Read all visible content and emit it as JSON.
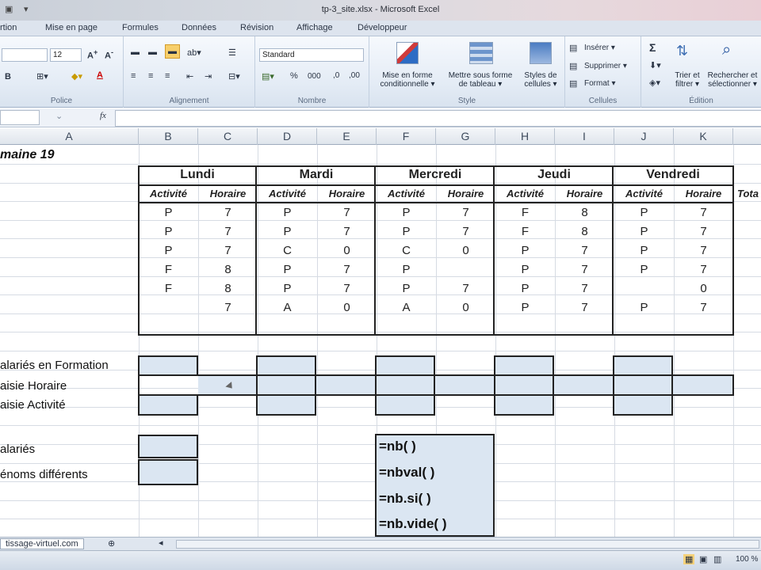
{
  "window": {
    "title": "tp-3_site.xlsx - Microsoft Excel"
  },
  "ribbon": {
    "tabs": [
      "rtion",
      "Mise en page",
      "Formules",
      "Données",
      "Révision",
      "Affichage",
      "Développeur"
    ],
    "font_size": "12",
    "number_format": "Standard",
    "groups": {
      "police": "Police",
      "alignement": "Alignement",
      "nombre": "Nombre",
      "style": "Style",
      "cellules": "Cellules",
      "edition": "Édition"
    },
    "style_buttons": {
      "mise_en_forme": [
        "Mise en forme",
        "conditionnelle ▾"
      ],
      "mettre_tableau": [
        "Mettre sous forme",
        "de tableau ▾"
      ],
      "styles_cellules": [
        "Styles de",
        "cellules ▾"
      ]
    },
    "cells_buttons": {
      "inserer": "Insérer ▾",
      "supprimer": "Supprimer ▾",
      "format": "Format ▾"
    },
    "edit_buttons": {
      "trier": [
        "Trier et",
        "filtrer ▾"
      ],
      "rechercher": [
        "Rechercher et",
        "sélectionner ▾"
      ]
    },
    "percent": "%",
    "thousands": "000",
    "sigma": "Σ"
  },
  "formula_bar": {
    "fx": "fx",
    "value": ""
  },
  "columns": [
    "A",
    "B",
    "C",
    "D",
    "E",
    "F",
    "G",
    "H",
    "I",
    "J",
    "K"
  ],
  "sheet": {
    "title": "maine 19",
    "days": [
      "Lundi",
      "Mardi",
      "Mercredi",
      "Jeudi",
      "Vendredi"
    ],
    "sub_activite": "Activité",
    "sub_horaire": "Horaire",
    "total_header": "Tota",
    "rows": [
      [
        "P",
        "7",
        "P",
        "7",
        "P",
        "7",
        "F",
        "8",
        "P",
        "7"
      ],
      [
        "P",
        "7",
        "P",
        "7",
        "P",
        "7",
        "F",
        "8",
        "P",
        "7"
      ],
      [
        "P",
        "7",
        "C",
        "0",
        "C",
        "0",
        "P",
        "7",
        "P",
        "7"
      ],
      [
        "F",
        "8",
        "P",
        "7",
        "P",
        "",
        "P",
        "7",
        "P",
        "7"
      ],
      [
        "F",
        "8",
        "P",
        "7",
        "P",
        "7",
        "P",
        "7",
        "",
        "0"
      ],
      [
        "",
        "7",
        "A",
        "0",
        "A",
        "0",
        "P",
        "7",
        "P",
        "7"
      ]
    ],
    "labels": {
      "formation": "alariés en Formation",
      "saisie_horaire": "aisie Horaire",
      "saisie_activite": "aisie Activité",
      "salaries": "alariés",
      "prenoms": "énoms différents"
    },
    "formulas": [
      "=nb( )",
      "=nbval( )",
      "=nb.si( )",
      "=nb.vide( )"
    ]
  },
  "sheet_tabs": {
    "site": "tissage-virtuel.com"
  },
  "status": {
    "zoom": "100 %"
  }
}
